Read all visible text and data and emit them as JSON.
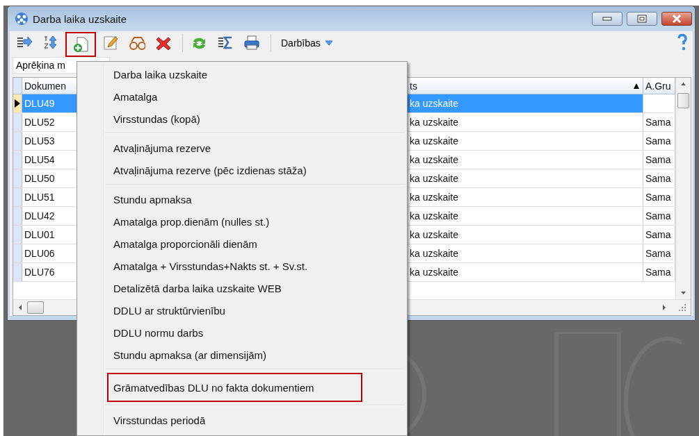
{
  "window": {
    "title": "Darba laika uzskaite"
  },
  "toolbar": {
    "buttons": [
      {
        "highlighted": false
      },
      {
        "highlighted": false
      },
      {
        "highlighted": true
      },
      {
        "highlighted": false
      },
      {
        "highlighted": false
      },
      {
        "highlighted": false
      },
      {
        "highlighted": false
      },
      {
        "highlighted": false
      },
      {
        "highlighted": false
      }
    ],
    "actions_menu": "Darbības"
  },
  "filter": {
    "value": "Aprēķina m"
  },
  "table": {
    "columns": [
      "Dokumen",
      "ts",
      "A.Gru"
    ],
    "rows": [
      {
        "cells": [
          "DLU49",
          "ka uzskaite"
        ],
        "selected": true
      },
      {
        "cells": [
          "DLU52",
          "ka uzskaite",
          "Sama"
        ],
        "selected": false
      },
      {
        "cells": [
          "DLU53",
          "ka uzskaite",
          "Sama"
        ],
        "selected": false
      },
      {
        "cells": [
          "DLU54",
          "ka uzskaite",
          "Sama"
        ],
        "selected": false
      },
      {
        "cells": [
          "DLU50",
          "ka uzskaite",
          "Sama"
        ],
        "selected": false
      },
      {
        "cells": [
          "DLU51",
          "ka uzskaite",
          "Sama"
        ],
        "selected": false
      },
      {
        "cells": [
          "DLU42",
          "ka uzskaite",
          "Sama"
        ],
        "selected": false
      },
      {
        "cells": [
          "DLU01",
          "ka uzskaite",
          "Sama"
        ],
        "selected": false
      },
      {
        "cells": [
          "DLU06",
          "ka uzskaite",
          "Sama"
        ],
        "selected": false
      },
      {
        "cells": [
          "DLU76",
          "ka uzskaite",
          "Sama"
        ],
        "selected": false
      }
    ]
  },
  "menu": {
    "groups": [
      [
        {
          "label": "Darba laika uzskaite",
          "highlighted": false
        },
        {
          "label": "Amatalga",
          "highlighted": false
        },
        {
          "label": "Virsstundas (kopā)",
          "highlighted": false
        }
      ],
      [
        {
          "label": "Atvaļinājuma rezerve",
          "highlighted": false
        },
        {
          "label": "Atvaļinājuma rezerve (pēc izdienas stāža)",
          "highlighted": false
        }
      ],
      [
        {
          "label": "Stundu apmaksa",
          "highlighted": false
        },
        {
          "label": "Amatalga prop.dienām (nulles st.)",
          "highlighted": false
        },
        {
          "label": "Amatalga proporcionāli dienām",
          "highlighted": false
        },
        {
          "label": "Amatalga + Virsstundas+Nakts st. + Sv.st.",
          "highlighted": false
        },
        {
          "label": "Detalizētā darba laika uzskaite WEB",
          "highlighted": false
        },
        {
          "label": "DDLU ar struktūrvienību",
          "highlighted": false
        },
        {
          "label": "DDLU normu darbs",
          "highlighted": false
        },
        {
          "label": "Stundu apmaksa (ar dimensijām)",
          "highlighted": false
        }
      ],
      [
        {
          "label": "Grāmatvedības DLU no fakta dokumentiem",
          "highlighted": true
        }
      ],
      [
        {
          "label": "Virsstundas periodā",
          "highlighted": false
        }
      ]
    ]
  }
}
